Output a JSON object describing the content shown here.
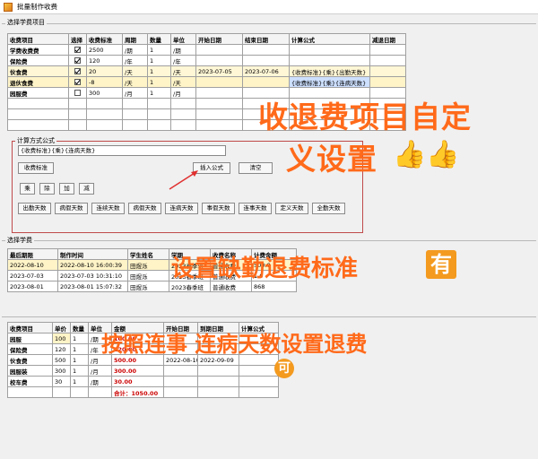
{
  "window": {
    "title": "批量制作收费"
  },
  "section1": {
    "label": "选择学费项目",
    "headers": [
      "收费项目",
      "选择",
      "收费标准",
      "周期",
      "数量",
      "单位",
      "开始日期",
      "结束日期",
      "计算公式",
      "减退日期"
    ],
    "rows": [
      {
        "name": "学费收费费",
        "checked": true,
        "standard": "2500",
        "period": "/期",
        "qty": "1",
        "unit": "/期",
        "start": "",
        "end": "",
        "formula": "",
        "refund": ""
      },
      {
        "name": "保险费",
        "checked": true,
        "standard": "120",
        "period": "/年",
        "qty": "1",
        "unit": "/年",
        "start": "",
        "end": "",
        "formula": "",
        "refund": ""
      },
      {
        "name": "伙食费",
        "checked": true,
        "standard": "20",
        "period": "/天",
        "qty": "1",
        "unit": "/天",
        "start": "2023-07-05",
        "end": "2023-07-06",
        "formula": "{收费标准}{乘}{出勤天数}",
        "refund": ""
      },
      {
        "name": "退伙食费",
        "checked": true,
        "standard": "-8",
        "period": "/天",
        "qty": "1",
        "unit": "/天",
        "start": "",
        "end": "",
        "formula": "{收费标准}{乘}{连病天数}",
        "refund": ""
      },
      {
        "name": "园服费",
        "checked": false,
        "standard": "300",
        "period": "/月",
        "qty": "1",
        "unit": "/月",
        "start": "",
        "end": "",
        "formula": "",
        "refund": ""
      }
    ]
  },
  "formula_panel": {
    "label": "计算方式公式",
    "formula_value": "{收费标准}{乘}{连病天数}",
    "std_button": "收费标准",
    "insert_button": "插入公式",
    "clear_button": "清空",
    "ops": [
      "乘",
      "除",
      "加",
      "减"
    ],
    "days_buttons": [
      "出勤天数",
      "病假天数",
      "连续天数",
      "病假天数",
      "连病天数",
      "事假天数",
      "连事天数",
      "定义天数",
      "全勤天数"
    ]
  },
  "section2": {
    "label": "选择学费",
    "headers": [
      "最后期限",
      "制作时间",
      "学生姓名",
      "学期",
      "收费名称",
      "计费金额"
    ],
    "rows": [
      {
        "deadline": "2022-08-10",
        "made": "2022-08-10 16:00:39",
        "student": "田煜泺",
        "term": "2023春季班",
        "name": "普通收费",
        "amount": "500.0"
      },
      {
        "deadline": "2023-07-03",
        "made": "2023-07-03 10:31:10",
        "student": "田煜泺",
        "term": "2023春季班",
        "name": "普通收费",
        "amount": "1.0"
      },
      {
        "deadline": "2023-08-01",
        "made": "2023-08-01 15:07:32",
        "student": "田煜泺",
        "term": "2023春季班",
        "name": "普通收费",
        "amount": "868"
      }
    ]
  },
  "section3": {
    "headers": [
      "收费项目",
      "单价",
      "数量",
      "单位",
      "金额",
      "开始日期",
      "到期日期",
      "计算公式"
    ],
    "rows": [
      {
        "name": "园服",
        "price": "100",
        "qty": "1",
        "unit": "/期",
        "amount": "100.00",
        "start": "",
        "end": "",
        "formula": ""
      },
      {
        "name": "保险费",
        "price": "120",
        "qty": "1",
        "unit": "/年",
        "amount": "120.00",
        "start": "",
        "end": "",
        "formula": ""
      },
      {
        "name": "伙食费",
        "price": "500",
        "qty": "1",
        "unit": "/月",
        "amount": "500.00",
        "start": "2022-08-10",
        "end": "2022-09-09",
        "formula": ""
      },
      {
        "name": "园服装",
        "price": "300",
        "qty": "1",
        "unit": "/月",
        "amount": "300.00",
        "start": "",
        "end": "",
        "formula": ""
      },
      {
        "name": "校车费",
        "price": "30",
        "qty": "1",
        "unit": "/期",
        "amount": "30.00",
        "start": "",
        "end": "",
        "formula": ""
      }
    ],
    "total": "合计：1050.00"
  },
  "overlay": {
    "line1": "收退费项目自定",
    "line2": "义设置",
    "line3": "设置缺勤退费标准",
    "badge1": "有",
    "line4": "按照连事 连病天数设置退费",
    "badge2": "可"
  }
}
